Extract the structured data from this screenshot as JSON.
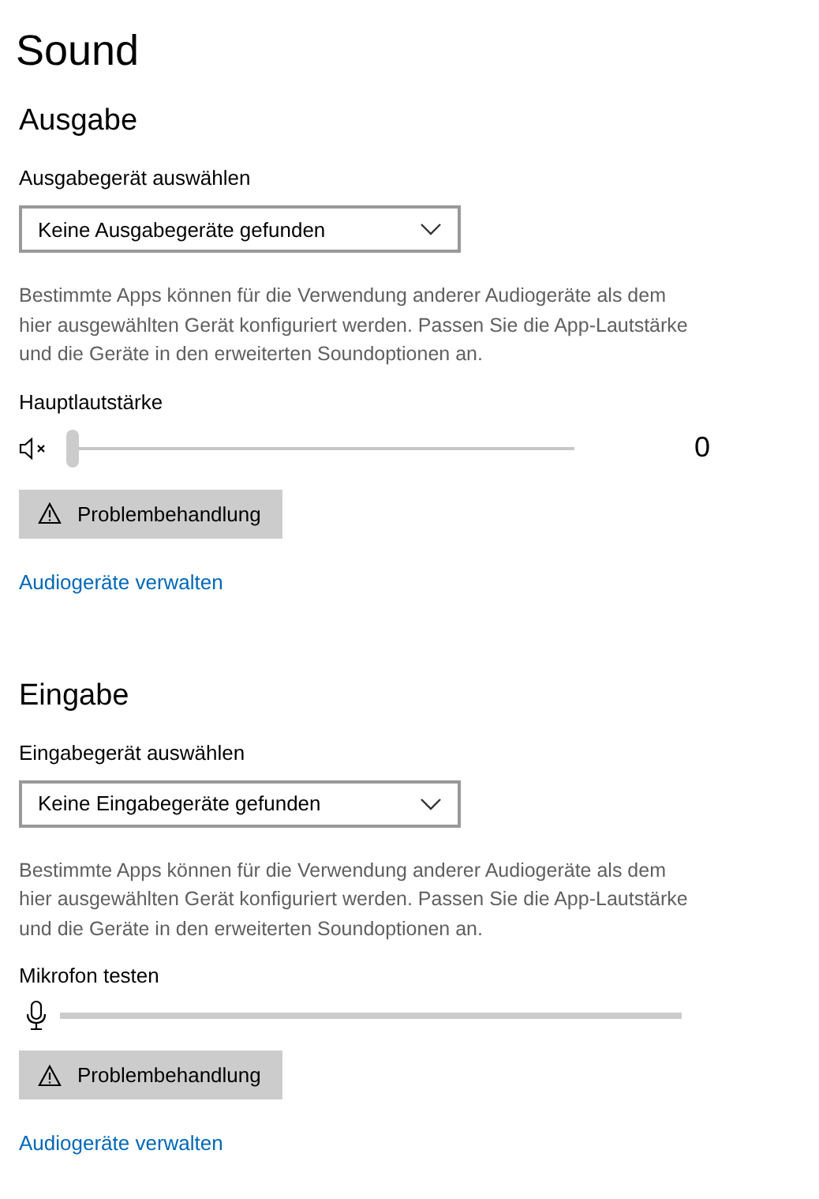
{
  "title": "Sound",
  "sections": [
    {
      "kind": "output",
      "heading": "Ausgabe",
      "device_label": "Ausgabegerät auswählen",
      "device_value": "Keine Ausgabegeräte gefunden",
      "description": "Bestimmte Apps können für die Verwendung anderer Audiogeräte als dem hier ausgewählten Gerät konfiguriert werden. Passen Sie die App-Lautstärke und die Geräte in den erweiterten Soundoptionen an.",
      "control_label": "Hauptlautstärke",
      "muted": true,
      "level": 0,
      "reading": "0",
      "troubleshoot_button": "Problembehandlung",
      "link": "Audiogeräte verwalten"
    },
    {
      "kind": "input",
      "heading": "Eingabe",
      "device_label": "Eingabegerät auswählen",
      "device_value": "Keine Eingabegeräte gefunden",
      "description": "Bestimmte Apps können für die Verwendung anderer Audiogeräte als dem hier ausgewählten Gerät konfiguriert werden. Passen Sie die App-Lautstärke und die Geräte in den erweiterten Soundoptionen an.",
      "control_label": "Mikrofon testen",
      "level": 0,
      "troubleshoot_button": "Problembehandlung",
      "link": "Audiogeräte verwalten"
    }
  ]
}
